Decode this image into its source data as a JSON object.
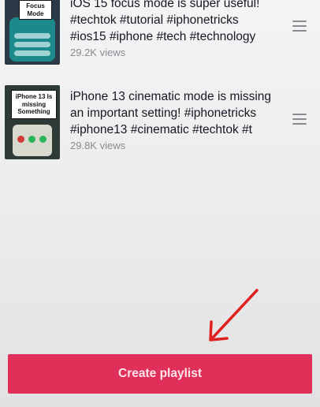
{
  "videos": [
    {
      "title_line1": "iOS 15 focus mode is super useful!",
      "title_line2": "#techtok #tutorial #iphonetricks",
      "title_line3": "#ios15 #iphone #tech #technology",
      "views": "29.2K views",
      "thumb_text": "Focus Mode"
    },
    {
      "title_line1": "iPhone 13 cinematic mode is missing",
      "title_line2": "an important setting! #iphonetricks",
      "title_line3": "#iphone13 #cinematic #techtok #t",
      "views": "29.8K views",
      "thumb_text": "iPhone 13 Is missing Something"
    }
  ],
  "create_playlist_label": "Create playlist",
  "colors": {
    "accent": "#e0305a",
    "arrow": "#e02020"
  }
}
